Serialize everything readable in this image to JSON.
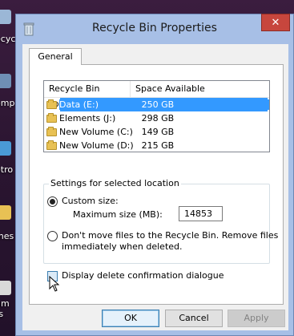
{
  "desktop": {
    "labels": [
      "ecycl",
      "omp",
      "etro",
      "mes",
      "um",
      "ts"
    ]
  },
  "window": {
    "title": "Recycle Bin Properties",
    "close_label": "✕"
  },
  "tabs": [
    {
      "label": "General"
    }
  ],
  "list": {
    "columns": [
      "Recycle Bin Location",
      "Space Available"
    ],
    "rows": [
      {
        "name": "Data (E:)",
        "size": "250 GB",
        "selected": true
      },
      {
        "name": "Elements (J:)",
        "size": "298 GB",
        "selected": false
      },
      {
        "name": "New Volume (C:)",
        "size": "149 GB",
        "selected": false
      },
      {
        "name": "New Volume (D:)",
        "size": "215 GB",
        "selected": false
      }
    ]
  },
  "settings": {
    "group_title": "Settings for selected location",
    "custom_size_label": "Custom size:",
    "max_size_label": "Maximum size (MB):",
    "max_size_value": "14853",
    "no_move_label_line1": "Don't move files to the Recycle Bin. Remove files",
    "no_move_label_line2": "immediately when deleted.",
    "selected_option": "custom"
  },
  "confirm_label": "Display delete confirmation dialogue",
  "buttons": {
    "ok": "OK",
    "cancel": "Cancel",
    "apply": "Apply"
  }
}
